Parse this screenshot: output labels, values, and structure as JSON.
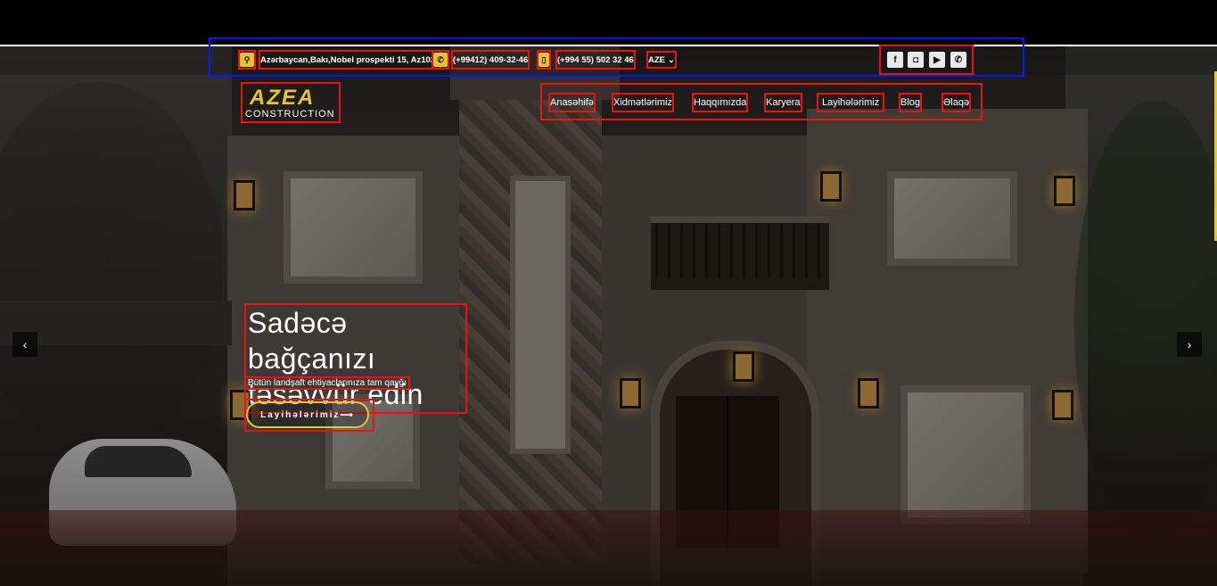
{
  "topbar": {
    "address": "Azərbaycan,Bakı,Nobel prospekti 15, Az1025",
    "phone1": "(+99412) 409-32-46",
    "phone2": "(+994 55) 502 32 46",
    "language": "AZE",
    "social": [
      "facebook-icon",
      "instagram-icon",
      "youtube-icon",
      "whatsapp-icon"
    ],
    "social_glyphs": [
      "f",
      "◘",
      "▶",
      "✆"
    ]
  },
  "logo": {
    "mark": "AZEA",
    "sub": "CONSTRUCTION"
  },
  "nav": [
    "Anasəhifə",
    "Xidmətlərimiz",
    "Haqqımızda",
    "Karyera",
    "Layihələrimiz",
    "Blog",
    "Əlaqə"
  ],
  "hero": {
    "title_line1": "Sadəcə bağçanızı",
    "title_line2": "təsəvvür edin",
    "subtitle": "Bütün landşaft ehtiyaclarınıza tam qayğı",
    "cta": "Layihələrimiz⟶"
  },
  "arrows": {
    "prev": "‹",
    "next": "›"
  },
  "colors": {
    "accent": "#e6c52a",
    "highlight": "#e11111",
    "blue_box": "#0019ff"
  }
}
